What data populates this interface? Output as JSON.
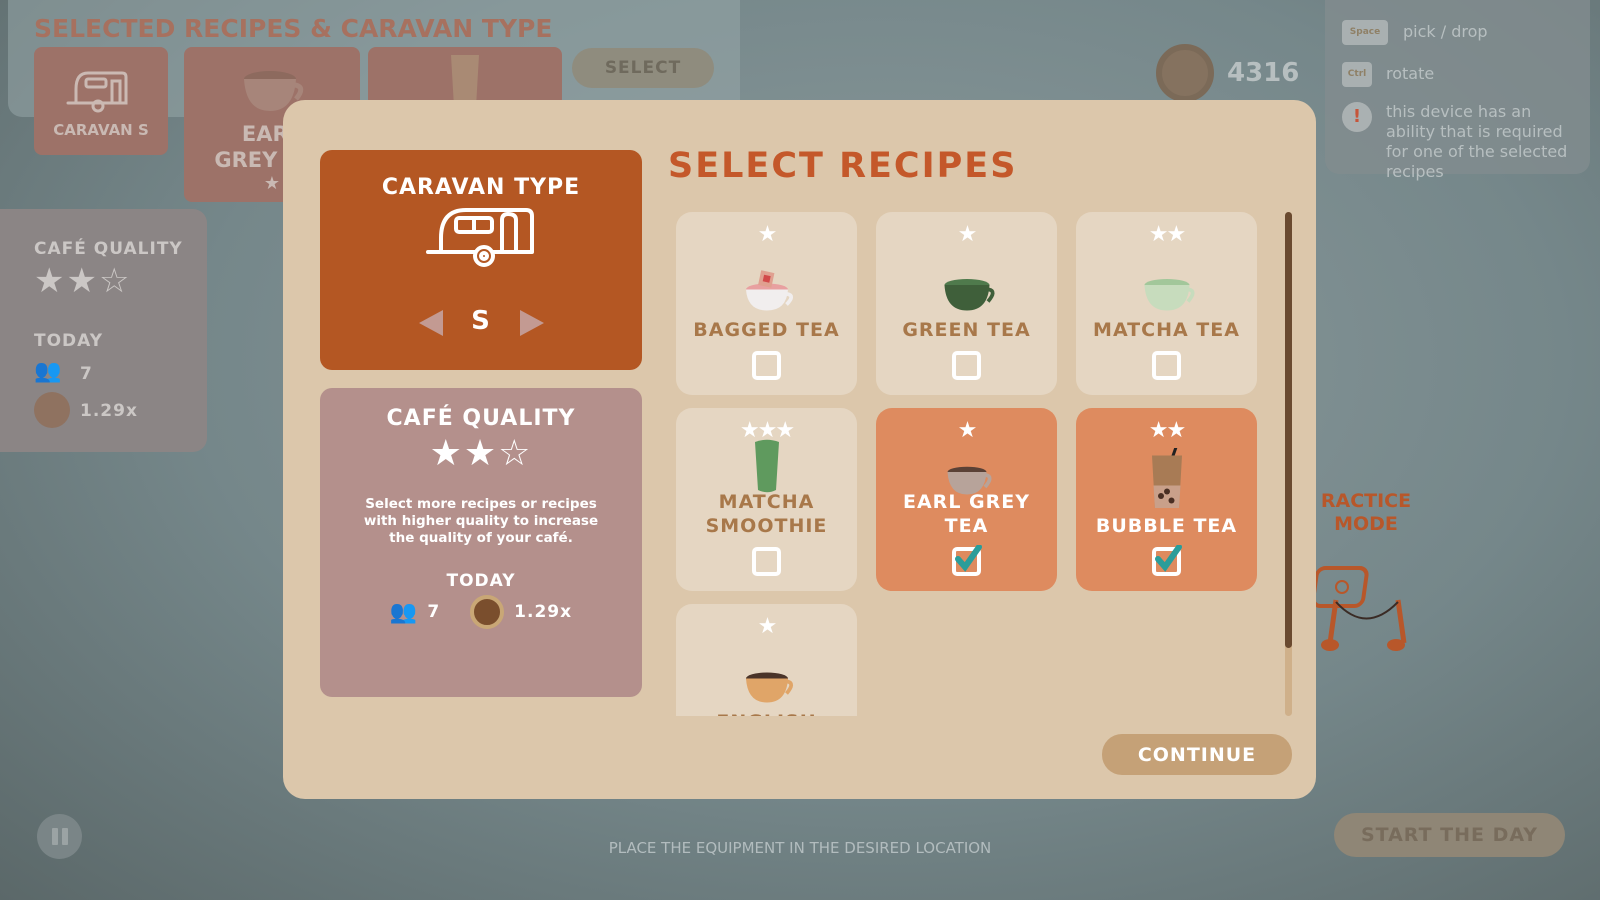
{
  "background": {
    "selected_title": "SELECTED RECIPES & CARAVAN TYPE",
    "selected_items": [
      {
        "label": "CARAVAN S"
      },
      {
        "label": "EARL GREY TEA",
        "stars": "★"
      },
      {
        "label": ""
      }
    ],
    "select_label": "SELECT",
    "coins": "4316",
    "side_panel": {
      "title": "CAFÉ QUALITY",
      "stars": "★★☆",
      "today_label": "TODAY",
      "guests": "7",
      "multiplier": "1.29x"
    },
    "help": [
      {
        "key": "Space",
        "text": "pick / drop"
      },
      {
        "key": "Ctrl",
        "text": "rotate"
      },
      {
        "key": "!",
        "text": "this device has an ability that is required for one of the selected recipes"
      }
    ],
    "practice_mode": "RACTICE MODE",
    "start_day_label": "START THE DAY",
    "hint": "PLACE THE EQUIPMENT IN THE DESIRED LOCATION"
  },
  "modal": {
    "caravan": {
      "title": "CARAVAN TYPE",
      "size": "S"
    },
    "quality": {
      "title": "CAFÉ QUALITY",
      "rating": 2,
      "max_rating": 3,
      "stars": "★★☆",
      "description": "Select more recipes or recipes with higher quality to increase the quality of your café.",
      "today_label": "TODAY",
      "guests": "7",
      "multiplier": "1.29x"
    },
    "recipes_title": "SELECT RECIPES",
    "recipes": [
      {
        "name": "BAGGED TEA",
        "stars": "★",
        "selected": false
      },
      {
        "name": "GREEN TEA",
        "stars": "★",
        "selected": false
      },
      {
        "name": "MATCHA TEA",
        "stars": "★★",
        "selected": false
      },
      {
        "name": "MATCHA SMOOTHIE",
        "stars": "★★★",
        "selected": false
      },
      {
        "name": "EARL GREY TEA",
        "stars": "★",
        "selected": true
      },
      {
        "name": "BUBBLE TEA",
        "stars": "★★",
        "selected": true
      },
      {
        "name": "ENGLISH",
        "stars": "★",
        "selected": false
      }
    ],
    "continue_label": "CONTINUE"
  },
  "colors": {
    "accent": "#b45723",
    "selected_card": "#de8b5f",
    "check": "#2a9d9a",
    "title": "#c4582a"
  }
}
